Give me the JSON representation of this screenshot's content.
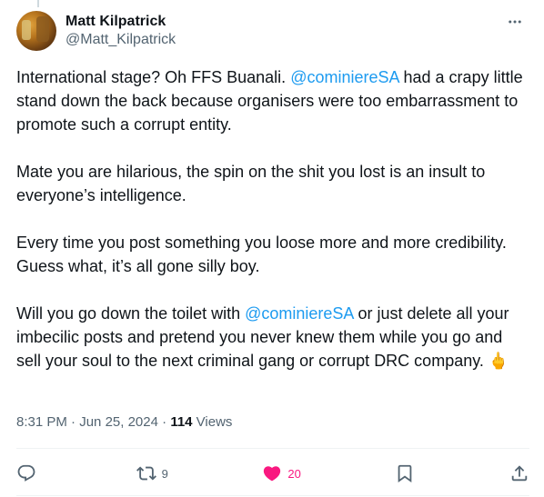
{
  "author": {
    "display_name": "Matt Kilpatrick",
    "handle": "@Matt_Kilpatrick"
  },
  "post": {
    "paragraphs": [
      {
        "segments": [
          {
            "text": "International stage? Oh FFS Buanali. ",
            "type": "text"
          },
          {
            "text": "@cominiereSA",
            "type": "mention"
          },
          {
            "text": " had a crapy little stand down the back because organisers were too embarrassment to promote such a corrupt entity.",
            "type": "text"
          }
        ]
      },
      {
        "segments": [
          {
            "text": "Mate you are hilarious, the spin on the shit you lost is an insult to everyone’s intelligence.",
            "type": "text"
          }
        ]
      },
      {
        "segments": [
          {
            "text": "Every time you post something you loose more and more credibility. Guess what, it’s all gone silly boy.",
            "type": "text"
          }
        ]
      },
      {
        "segments": [
          {
            "text": "Will you go down the toilet with ",
            "type": "text"
          },
          {
            "text": "@cominiereSA",
            "type": "mention"
          },
          {
            "text": " or just delete all your imbecilic posts and pretend you never knew them while you go and sell your soul to the next criminal gang or corrupt DRC company. ",
            "type": "text"
          },
          {
            "text": "🖕",
            "type": "emoji"
          }
        ]
      }
    ]
  },
  "meta": {
    "time": "8:31 PM",
    "separator": " · ",
    "date": "Jun 25, 2024",
    "views_count": "114",
    "views_label": " Views"
  },
  "actions": {
    "reply": {
      "icon": "reply-icon",
      "count": ""
    },
    "repost": {
      "icon": "repost-icon",
      "count": "9"
    },
    "like": {
      "icon": "heart-filled-icon",
      "count": "20",
      "color": "#f91880"
    },
    "bookmark": {
      "icon": "bookmark-icon",
      "count": ""
    },
    "share": {
      "icon": "share-icon",
      "count": ""
    }
  },
  "colors": {
    "accent": "#1d9bf0",
    "text": "#0f1419",
    "muted": "#536471",
    "like": "#f91880"
  }
}
